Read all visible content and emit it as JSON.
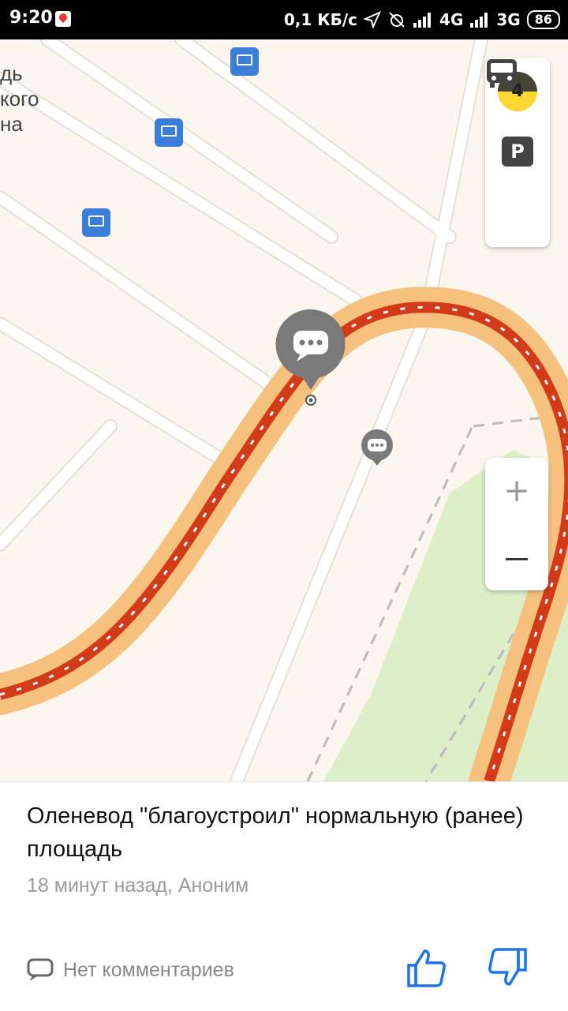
{
  "status_bar": {
    "time": "9:20",
    "net_speed": "0,1 КБ/с",
    "network_1": "4G",
    "network_2": "3G",
    "battery": "86"
  },
  "map": {
    "place_label_lines": [
      "дь",
      "кого",
      "на"
    ],
    "traffic_level": "4",
    "parking_label": "P",
    "zoom_in_label": "+",
    "colors": {
      "background": "#fbf7ee",
      "road": "#ffffff",
      "route_outer": "#f6c07e",
      "route_jam": "#d23b1a",
      "park": "#dcefc8",
      "bus_stop": "#3b7ed8"
    }
  },
  "card": {
    "title": "Оленевод \"благоустроил\" нормальную (ранее) площадь",
    "meta": "18 минут назад, Аноним",
    "comments_label": "Нет комментариев"
  }
}
